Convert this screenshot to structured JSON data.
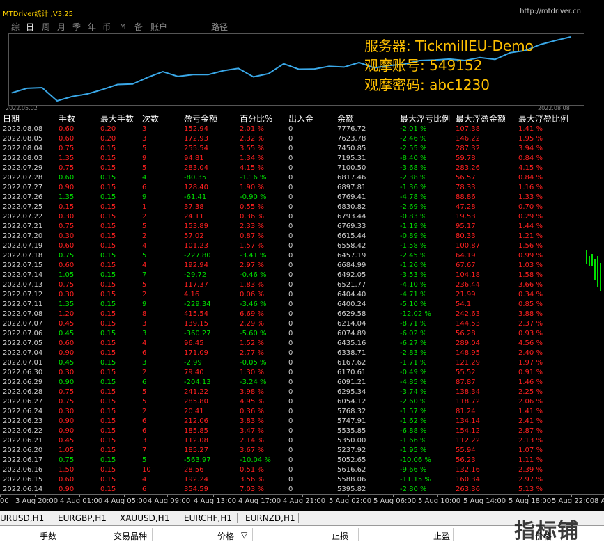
{
  "window": {
    "title": "MTDriver统计 ,V3.25",
    "url": "http://mtdriver.cn"
  },
  "tabs": [
    {
      "label": "综",
      "selected": false
    },
    {
      "label": "日",
      "selected": true
    },
    {
      "label": "周",
      "selected": false
    },
    {
      "label": "月",
      "selected": false
    },
    {
      "label": "季",
      "selected": false
    },
    {
      "label": "年",
      "selected": false
    },
    {
      "label": "币",
      "selected": false
    },
    {
      "label": "M",
      "selected": false
    },
    {
      "label": "备",
      "selected": false
    },
    {
      "label": "账户",
      "selected": false
    },
    {
      "label": "路径",
      "selected": false
    }
  ],
  "info": {
    "server": "服务器: TickmillEU-Demo",
    "account": "观摩账号:  549152",
    "password": "观摩密码:  abc1230"
  },
  "chart_data": {
    "type": "line",
    "x_start": "2022.05.02",
    "x_end": "2022.08.08",
    "color": "#3aa8e8",
    "values": [
      5395.82,
      5588.06,
      5616.62,
      5052.65,
      5237.92,
      5350.0,
      5535.85,
      5747.91,
      5768.32,
      6054.12,
      6295.34,
      6091.21,
      6170.61,
      6167.62,
      6338.71,
      6435.16,
      6074.89,
      6214.04,
      6629.58,
      6400.24,
      6404.4,
      6521.77,
      6492.05,
      6684.99,
      6457.19,
      6558.42,
      6615.44,
      6769.33,
      6793.44,
      6830.82,
      6769.41,
      6897.81,
      6817.46,
      7100.5,
      7195.31,
      7450.85,
      7623.78,
      7776.72
    ]
  },
  "table": {
    "headers": [
      "日期",
      "手数",
      "最大手数",
      "次数",
      "盈亏金额",
      "百分比%",
      "出入金",
      "余额",
      "最大浮亏比例",
      "最大浮盈金额",
      "最大浮盈比例"
    ],
    "rows": [
      [
        "2022.08.08",
        "0.60",
        "0.20",
        "3",
        "152.94",
        "2.01 %",
        "0",
        "7776.72",
        "-2.01 %",
        "107.38",
        "1.41 %"
      ],
      [
        "2022.08.05",
        "0.60",
        "0.20",
        "3",
        "172.93",
        "2.32 %",
        "0",
        "7623.78",
        "-2.46 %",
        "146.22",
        "1.95 %"
      ],
      [
        "2022.08.04",
        "0.75",
        "0.15",
        "5",
        "255.54",
        "3.55 %",
        "0",
        "7450.85",
        "-2.55 %",
        "287.32",
        "3.94 %"
      ],
      [
        "2022.08.03",
        "1.35",
        "0.15",
        "9",
        "94.81",
        "1.34 %",
        "0",
        "7195.31",
        "-8.40 %",
        "59.78",
        "0.84 %"
      ],
      [
        "2022.07.29",
        "0.75",
        "0.15",
        "5",
        "283.04",
        "4.15 %",
        "0",
        "7100.50",
        "-3.68 %",
        "283.26",
        "4.15 %"
      ],
      [
        "2022.07.28",
        "0.60",
        "0.15",
        "4",
        "-80.35",
        "-1.16 %",
        "0",
        "6817.46",
        "-2.38 %",
        "56.57",
        "0.84 %"
      ],
      [
        "2022.07.27",
        "0.90",
        "0.15",
        "6",
        "128.40",
        "1.90 %",
        "0",
        "6897.81",
        "-1.36 %",
        "78.33",
        "1.16 %"
      ],
      [
        "2022.07.26",
        "1.35",
        "0.15",
        "9",
        "-61.41",
        "-0.90 %",
        "0",
        "6769.41",
        "-4.78 %",
        "88.86",
        "1.33 %"
      ],
      [
        "2022.07.25",
        "0.15",
        "0.15",
        "1",
        "37.38",
        "0.55 %",
        "0",
        "6830.82",
        "-2.69 %",
        "47.28",
        "0.70 %"
      ],
      [
        "2022.07.22",
        "0.30",
        "0.15",
        "2",
        "24.11",
        "0.36 %",
        "0",
        "6793.44",
        "-0.83 %",
        "19.53",
        "0.29 %"
      ],
      [
        "2022.07.21",
        "0.75",
        "0.15",
        "5",
        "153.89",
        "2.33 %",
        "0",
        "6769.33",
        "-1.19 %",
        "95.17",
        "1.44 %"
      ],
      [
        "2022.07.20",
        "0.30",
        "0.15",
        "2",
        "57.02",
        "0.87 %",
        "0",
        "6615.44",
        "-0.89 %",
        "80.33",
        "1.21 %"
      ],
      [
        "2022.07.19",
        "0.60",
        "0.15",
        "4",
        "101.23",
        "1.57 %",
        "0",
        "6558.42",
        "-1.58 %",
        "100.87",
        "1.56 %"
      ],
      [
        "2022.07.18",
        "0.75",
        "0.15",
        "5",
        "-227.80",
        "-3.41 %",
        "0",
        "6457.19",
        "-2.45 %",
        "64.19",
        "0.99 %"
      ],
      [
        "2022.07.15",
        "0.60",
        "0.15",
        "4",
        "192.94",
        "2.97 %",
        "0",
        "6684.99",
        "-1.26 %",
        "67.67",
        "1.03 %"
      ],
      [
        "2022.07.14",
        "1.05",
        "0.15",
        "7",
        "-29.72",
        "-0.46 %",
        "0",
        "6492.05",
        "-3.53 %",
        "104.18",
        "1.58 %"
      ],
      [
        "2022.07.13",
        "0.75",
        "0.15",
        "5",
        "117.37",
        "1.83 %",
        "0",
        "6521.77",
        "-4.10 %",
        "236.44",
        "3.66 %"
      ],
      [
        "2022.07.12",
        "0.30",
        "0.15",
        "2",
        "4.16",
        "0.06 %",
        "0",
        "6404.40",
        "-4.71 %",
        "21.99",
        "0.34 %"
      ],
      [
        "2022.07.11",
        "1.35",
        "0.15",
        "9",
        "-229.34",
        "-3.46 %",
        "0",
        "6400.24",
        "-5.10 %",
        "54.1",
        "0.85 %"
      ],
      [
        "2022.07.08",
        "1.20",
        "0.15",
        "8",
        "415.54",
        "6.69 %",
        "0",
        "6629.58",
        "-12.02 %",
        "242.63",
        "3.88 %"
      ],
      [
        "2022.07.07",
        "0.45",
        "0.15",
        "3",
        "139.15",
        "2.29 %",
        "0",
        "6214.04",
        "-8.71 %",
        "144.53",
        "2.37 %"
      ],
      [
        "2022.07.06",
        "0.45",
        "0.15",
        "3",
        "-360.27",
        "-5.60 %",
        "0",
        "6074.89",
        "-6.02 %",
        "56.28",
        "0.93 %"
      ],
      [
        "2022.07.05",
        "0.60",
        "0.15",
        "4",
        "96.45",
        "1.52 %",
        "0",
        "6435.16",
        "-6.27 %",
        "289.04",
        "4.56 %"
      ],
      [
        "2022.07.04",
        "0.90",
        "0.15",
        "6",
        "171.09",
        "2.77 %",
        "0",
        "6338.71",
        "-2.83 %",
        "148.95",
        "2.40 %"
      ],
      [
        "2022.07.01",
        "0.45",
        "0.15",
        "3",
        "-2.99",
        "-0.05 %",
        "0",
        "6167.62",
        "-1.71 %",
        "121.29",
        "1.97 %"
      ],
      [
        "2022.06.30",
        "0.30",
        "0.15",
        "2",
        "79.40",
        "1.30 %",
        "0",
        "6170.61",
        "-0.49 %",
        "55.52",
        "0.91 %"
      ],
      [
        "2022.06.29",
        "0.90",
        "0.15",
        "6",
        "-204.13",
        "-3.24 %",
        "0",
        "6091.21",
        "-4.85 %",
        "87.87",
        "1.46 %"
      ],
      [
        "2022.06.28",
        "0.75",
        "0.15",
        "5",
        "241.22",
        "3.98 %",
        "0",
        "6295.34",
        "-3.74 %",
        "138.34",
        "2.25 %"
      ],
      [
        "2022.06.27",
        "0.75",
        "0.15",
        "5",
        "285.80",
        "4.95 %",
        "0",
        "6054.12",
        "-2.60 %",
        "118.72",
        "2.06 %"
      ],
      [
        "2022.06.24",
        "0.30",
        "0.15",
        "2",
        "20.41",
        "0.36 %",
        "0",
        "5768.32",
        "-1.57 %",
        "81.24",
        "1.41 %"
      ],
      [
        "2022.06.23",
        "0.90",
        "0.15",
        "6",
        "212.06",
        "3.83 %",
        "0",
        "5747.91",
        "-1.62 %",
        "134.14",
        "2.41 %"
      ],
      [
        "2022.06.22",
        "0.90",
        "0.15",
        "6",
        "185.85",
        "3.47 %",
        "0",
        "5535.85",
        "-6.88 %",
        "154.12",
        "2.87 %"
      ],
      [
        "2022.06.21",
        "0.45",
        "0.15",
        "3",
        "112.08",
        "2.14 %",
        "0",
        "5350.00",
        "-1.66 %",
        "112.22",
        "2.13 %"
      ],
      [
        "2022.06.20",
        "1.05",
        "0.15",
        "7",
        "185.27",
        "3.67 %",
        "0",
        "5237.92",
        "-1.95 %",
        "55.94",
        "1.07 %"
      ],
      [
        "2022.06.17",
        "0.75",
        "0.15",
        "5",
        "-563.97",
        "-10.04 %",
        "0",
        "5052.65",
        "-10.06 %",
        "56.23",
        "1.11 %"
      ],
      [
        "2022.06.16",
        "1.50",
        "0.15",
        "10",
        "28.56",
        "0.51 %",
        "0",
        "5616.62",
        "-9.66 %",
        "132.16",
        "2.39 %"
      ],
      [
        "2022.06.15",
        "0.60",
        "0.15",
        "4",
        "192.24",
        "3.56 %",
        "0",
        "5588.06",
        "-11.15 %",
        "160.34",
        "2.97 %"
      ],
      [
        "2022.06.14",
        "0.90",
        "0.15",
        "6",
        "354.59",
        "7.03 %",
        "0",
        "5395.82",
        "-2.80 %",
        "263.36",
        "5.13 %"
      ]
    ]
  },
  "time_axis": [
    "00",
    "3 Aug 20:00",
    "4 Aug 01:00",
    "4 Aug 05:00",
    "4 Aug 09:00",
    "4 Aug 13:00",
    "4 Aug 17:00",
    "4 Aug 21:00",
    "5 Aug 02:00",
    "5 Aug 06:00",
    "5 Aug 10:00",
    "5 Aug 14:00",
    "5 Aug 18:00",
    "5 Aug 22:00",
    "8 A"
  ],
  "symbol_tabs": [
    "URUSD,H1",
    "EURGBP,H1",
    "XAUUSD,H1",
    "EURCHF,H1",
    "EURNZD,H1"
  ],
  "terminal_headers": [
    "手数",
    "交易品种",
    "价格",
    "止损",
    "止盈",
    "价格"
  ],
  "watermark": "指标铺"
}
